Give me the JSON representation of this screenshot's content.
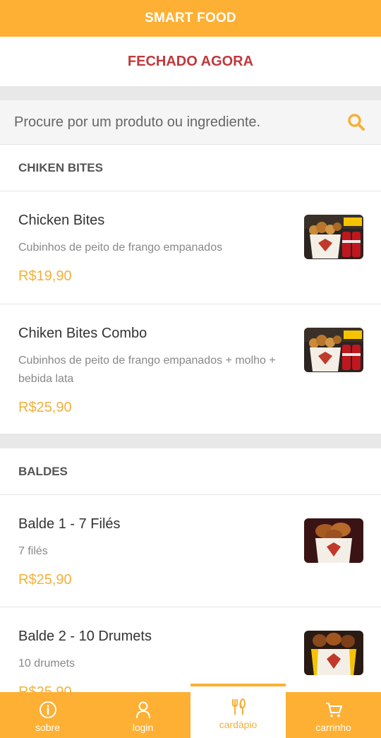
{
  "header": {
    "title": "SMART FOOD"
  },
  "status": {
    "text": "FECHADO AGORA"
  },
  "search": {
    "placeholder": "Procure por um produto ou ingrediente."
  },
  "colors": {
    "accent": "#fdb034",
    "closed": "#c0393b",
    "price": "#f5b039"
  },
  "sections": [
    {
      "title": "CHIKEN BITES",
      "items": [
        {
          "name": "Chicken Bites",
          "description": "Cubinhos de peito de frango empanados",
          "price": "R$19,90"
        },
        {
          "name": "Chiken Bites Combo",
          "description": "Cubinhos de peito de frango empanados + molho + bebida lata",
          "price": "R$25,90"
        }
      ]
    },
    {
      "title": "BALDES",
      "items": [
        {
          "name": "Balde 1 - 7 Filés",
          "description": "7 filés",
          "price": "R$25,90"
        },
        {
          "name": "Balde 2 - 10 Drumets",
          "description": "10 drumets",
          "price": "R$25,90"
        }
      ]
    }
  ],
  "nav": {
    "items": [
      {
        "label": "sobre",
        "icon": "info-icon"
      },
      {
        "label": "login",
        "icon": "user-icon"
      },
      {
        "label": "cardápio",
        "icon": "cutlery-icon"
      },
      {
        "label": "carrinho",
        "icon": "cart-icon"
      }
    ],
    "active": "cardápio"
  }
}
